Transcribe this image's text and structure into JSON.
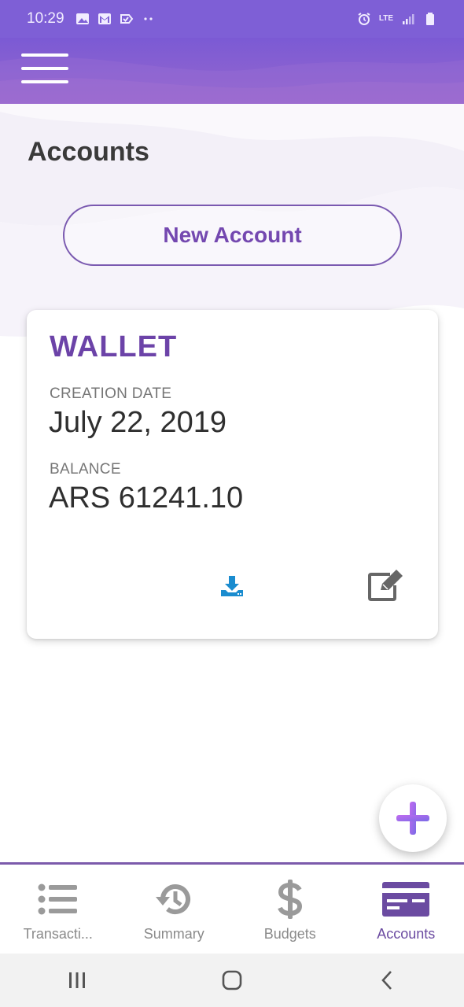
{
  "status_bar": {
    "time": "10:29",
    "network": "LTE",
    "icons": [
      "gallery-icon",
      "gmail-icon",
      "check-icon",
      "dots-icon",
      "alarm-icon",
      "signal-icon",
      "battery-icon"
    ]
  },
  "app_bar": {
    "menu_icon": "hamburger-menu-icon"
  },
  "page": {
    "title": "Accounts"
  },
  "new_account_button": {
    "label": "New Account"
  },
  "account_card": {
    "name": "WALLET",
    "creation_date_label": "CREATION DATE",
    "creation_date": "July 22, 2019",
    "balance_label": "BALANCE",
    "balance": "ARS 61241.10",
    "download_icon": "download-icon",
    "edit_icon": "edit-icon"
  },
  "fab": {
    "icon": "plus-icon"
  },
  "bottom_nav": {
    "items": [
      {
        "label": "Transacti...",
        "icon": "list-icon",
        "active": false
      },
      {
        "label": "Summary",
        "icon": "history-icon",
        "active": false
      },
      {
        "label": "Budgets",
        "icon": "dollar-icon",
        "active": false
      },
      {
        "label": "Accounts",
        "icon": "card-icon",
        "active": true
      }
    ]
  },
  "system_nav": {
    "icons": [
      "recents-icon",
      "home-icon",
      "back-icon"
    ]
  },
  "colors": {
    "primary": "#7e5fd6",
    "accent_purple": "#6c43a8",
    "download_blue": "#1a8ccf",
    "fab_gradient_start": "#c06bf0",
    "fab_gradient_end": "#7b6be6"
  }
}
